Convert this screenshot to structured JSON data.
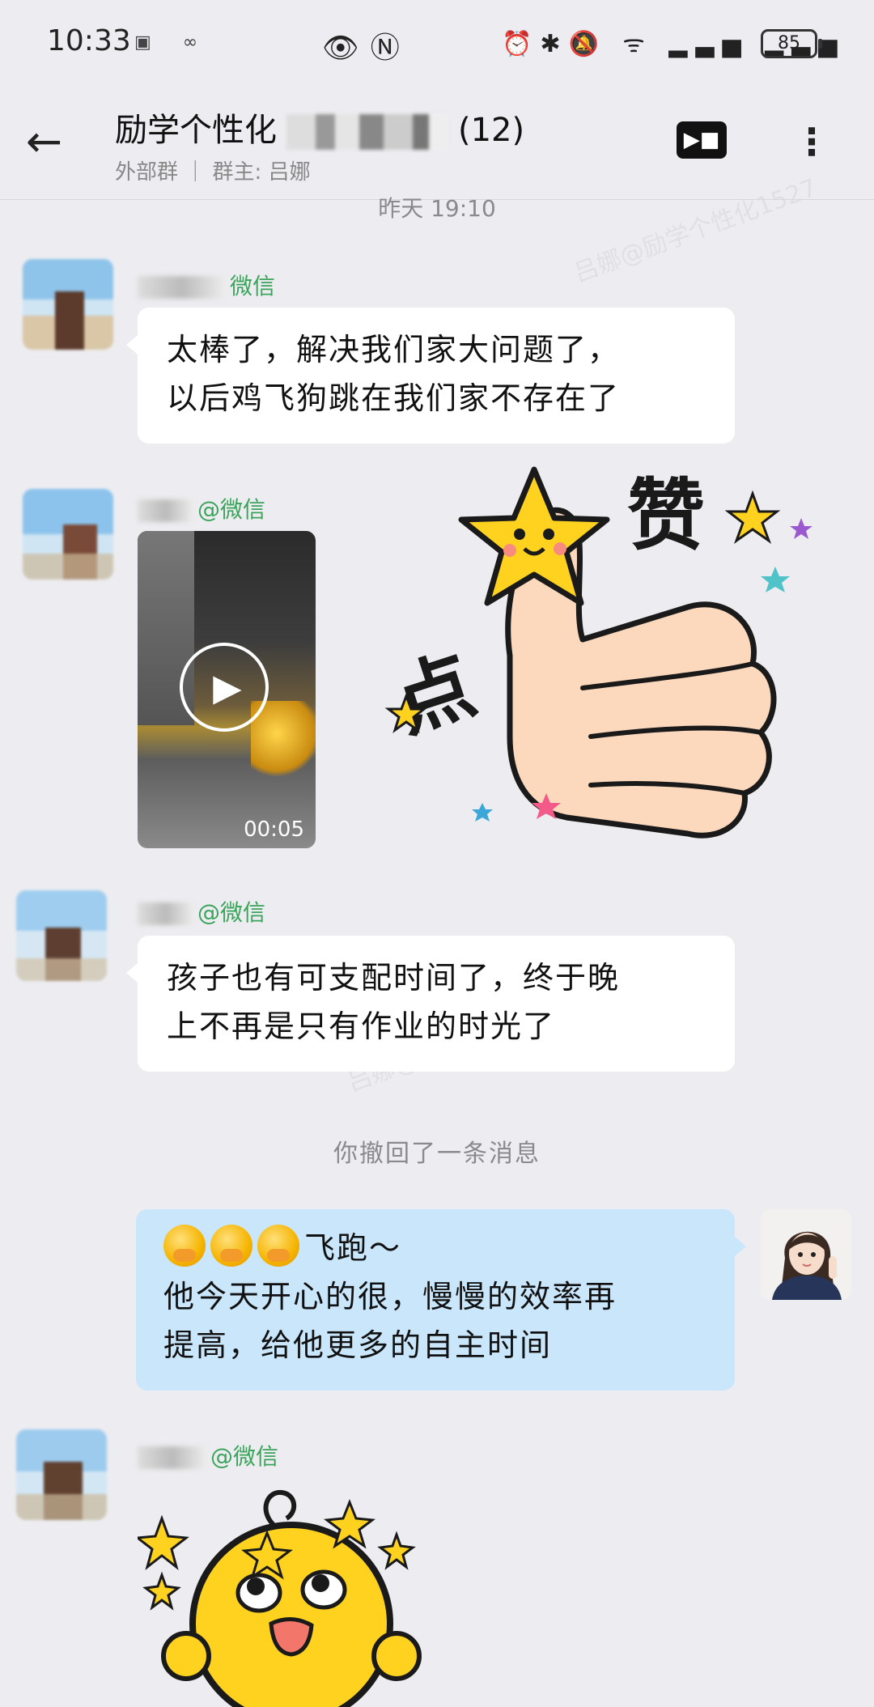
{
  "status_bar": {
    "time": "10:33",
    "battery": "85",
    "icons_left": [
      "image-icon",
      "link-icon"
    ],
    "icons_mid": [
      "eye-icon",
      "nfc-icon"
    ],
    "icons_right": [
      "alarm-icon",
      "bluetooth-icon",
      "mute-icon",
      "wifi-icon",
      "signal-icon",
      "signal-icon"
    ]
  },
  "header": {
    "title": "励学个性化",
    "member_count": "(12)",
    "group_type": "外部群",
    "owner": "群主: 吕娜"
  },
  "chat": {
    "timestamp": "昨天 19:10",
    "messages": [
      {
        "sender_suffix": "微信",
        "text_line1": "太棒了，解决我们家大问题了，",
        "text_line2": "以后鸡飞狗跳在我们家不存在了"
      },
      {
        "sender_suffix": "@微信",
        "video_duration": "00:05",
        "sticker_texts": [
          "赞",
          "点"
        ]
      },
      {
        "sender_suffix": "@微信",
        "text_line1": "孩子也有可支配时间了，终于晚",
        "text_line2": "上不再是只有作业的时光了"
      },
      {
        "recall_notice": "你撤回了一条消息"
      },
      {
        "mine": true,
        "text_line1": "飞跑～",
        "text_line2": "他今天开心的很，慢慢的效率再",
        "text_line3": "提高，给他更多的自主时间"
      },
      {
        "sender_suffix": "@微信"
      }
    ]
  },
  "colors": {
    "background": "#ededf1",
    "sender_name": "#3aa45a",
    "my_bubble": "#c9e6fb"
  }
}
